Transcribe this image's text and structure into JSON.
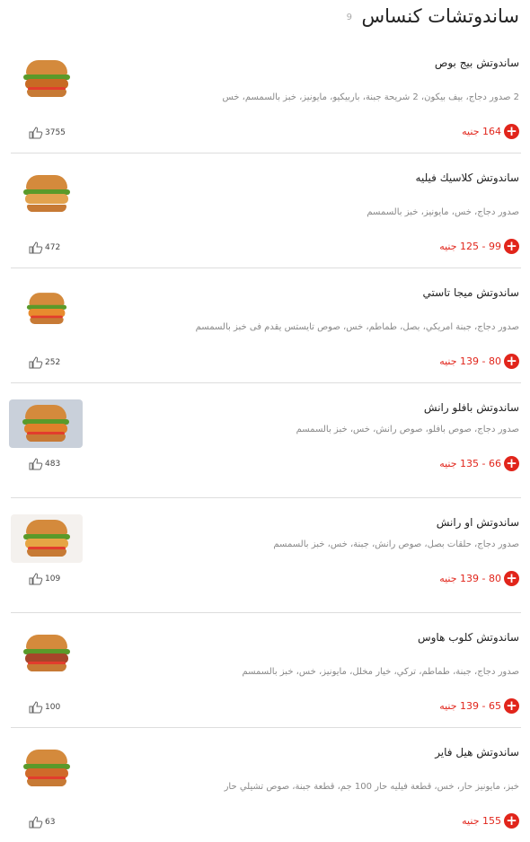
{
  "header": {
    "title": "ساندوتشات كنساس",
    "count": "9"
  },
  "items": [
    {
      "name": "ساندوتش بيج بوص",
      "description": "2 صدور دجاج، بيف بيكون، 2 شريحة جبنة، باربيكيو، مايونيز، خبز بالسمسم، خس",
      "price": "164 جنيه",
      "likes": "3755"
    },
    {
      "name": "ساندوتش كلاسيك فيليه",
      "description": "صدور دجاج، خس، مايونيز، خبز بالسمسم",
      "price": "99 - 125 جنيه",
      "likes": "472"
    },
    {
      "name": "ساندوتش ميجا تاستي",
      "description": "صدور دجاج، جبنة امريكي، بصل، طماطم، خس، صوص تايستس يقدم فى خبز بالسمسم",
      "price": "80 - 139 جنيه",
      "likes": "252"
    },
    {
      "name": "ساندوتش بافلو رانش",
      "description": "صدور دجاج، صوص بافلو، صوص رانش، خس، خبز بالسمسم",
      "price": "66 - 135 جنيه",
      "likes": "483"
    },
    {
      "name": "ساندوتش او رانش",
      "description": "صدور دجاج، حلقات بصل، صوص رانش، جبنة، خس، خبز بالسمسم",
      "price": "80 - 139 جنيه",
      "likes": "109"
    },
    {
      "name": "ساندوتش كلوب هاوس",
      "description": "صدور دجاج، جبنة، طماطم، تركي، خيار مخلل، مايونيز، خس، خبز بالسمسم",
      "price": "65 - 139 جنيه",
      "likes": "100"
    },
    {
      "name": "ساندوتش هيل فاير",
      "description": "خبز، مايونيز حار، خس، قطعة فيليه حار 100 جم، قطعة جبنة، صوص تشيلي حار",
      "price": "155 جنيه",
      "likes": "63"
    }
  ],
  "icons": {
    "add": "plus-circle-icon",
    "like": "thumbs-up-icon"
  },
  "colors": {
    "accent": "#e1251b"
  }
}
